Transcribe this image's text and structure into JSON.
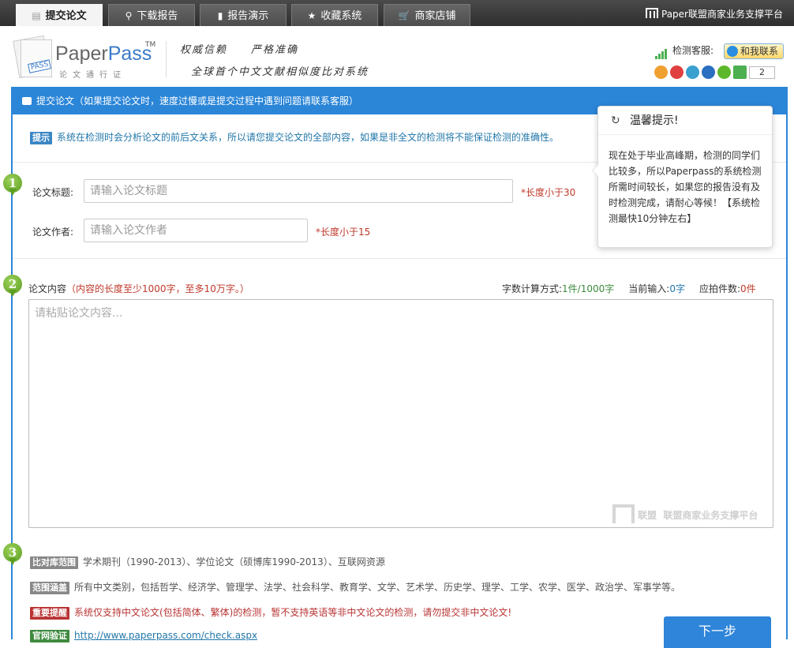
{
  "nav": {
    "tabs": [
      {
        "label": "提交论文",
        "icon": "document-icon"
      },
      {
        "label": "下载报告",
        "icon": "search-icon"
      },
      {
        "label": "报告演示",
        "icon": "file-icon"
      },
      {
        "label": "收藏系统",
        "icon": "star-icon"
      },
      {
        "label": "商家店铺",
        "icon": "cart-icon"
      }
    ],
    "brand_right": "Paper联盟商家业务支撑平台"
  },
  "header": {
    "logo_paper": "Paper",
    "logo_pass": "Pass",
    "logo_tm": "TM",
    "logo_badge": "PASS",
    "logo_sub": "论文通行证",
    "slogan_line1": "权威信赖　　严格准确",
    "slogan_line2": "全球首个中文文献相似度比对系统",
    "service_label": "检测客服:",
    "contact_button": "和我联系",
    "share_count": "2"
  },
  "panel": {
    "title": "提交论文（如果提交论文时，速度过慢或是提交过程中遇到问题请联系客服）",
    "tip_badge": "提示",
    "tip_text": "系统在检测时会分析论文的前后文关系，所以请您提交论文的全部内容，如果是非全文的检测将不能保证检测的准确性。",
    "steps": [
      "1",
      "2",
      "3"
    ],
    "title_label": "论文标题:",
    "title_placeholder": "请输入论文标题",
    "title_hint": "*长度小于30",
    "author_label": "论文作者:",
    "author_placeholder": "请输入论文作者",
    "author_hint": "*长度小于15",
    "content_label": "论文内容",
    "content_req": "（内容的长度至少1000字，至多10万字。）",
    "stats": {
      "calc_label": "字数计算方式:",
      "calc_value": "1件/1000字",
      "current_label": "当前输入:",
      "current_value": "0字",
      "pieces_label": "应拍件数:",
      "pieces_value": "0件"
    },
    "content_placeholder": "请粘贴论文内容...",
    "watermark_small": "联盟",
    "watermark_text": "联盟商家业务支撑平台",
    "scope_badge": "比对库范围",
    "scope_text": "学术期刊（1990-2013）、学位论文（硕博库1990-2013）、互联网资源",
    "coverage_badge": "范围涵盖",
    "coverage_text": "所有中文类别，包括哲学、经济学、管理学、法学、社会科学、教育学、文学、艺术学、历史学、理学、工学、农学、医学、政治学、军事学等。",
    "important_badge": "重要提醒",
    "important_text": "系统仅支持中文论文(包括简体、繁体)的检测，暂不支持英语等非中文论文的检测，请勿提交非中文论文!",
    "verify_badge": "官网验证",
    "verify_text": "http://www.paperpass.com/check.aspx",
    "next_button": "下一步"
  },
  "notice": {
    "title": "温馨提示!",
    "body": "现在处于毕业高峰期，检测的同学们比较多，所以Paperpass的系统检测所需时间较长，如果您的报告没有及时检测完成，请耐心等候！【系统检测最快10分钟左右】"
  }
}
